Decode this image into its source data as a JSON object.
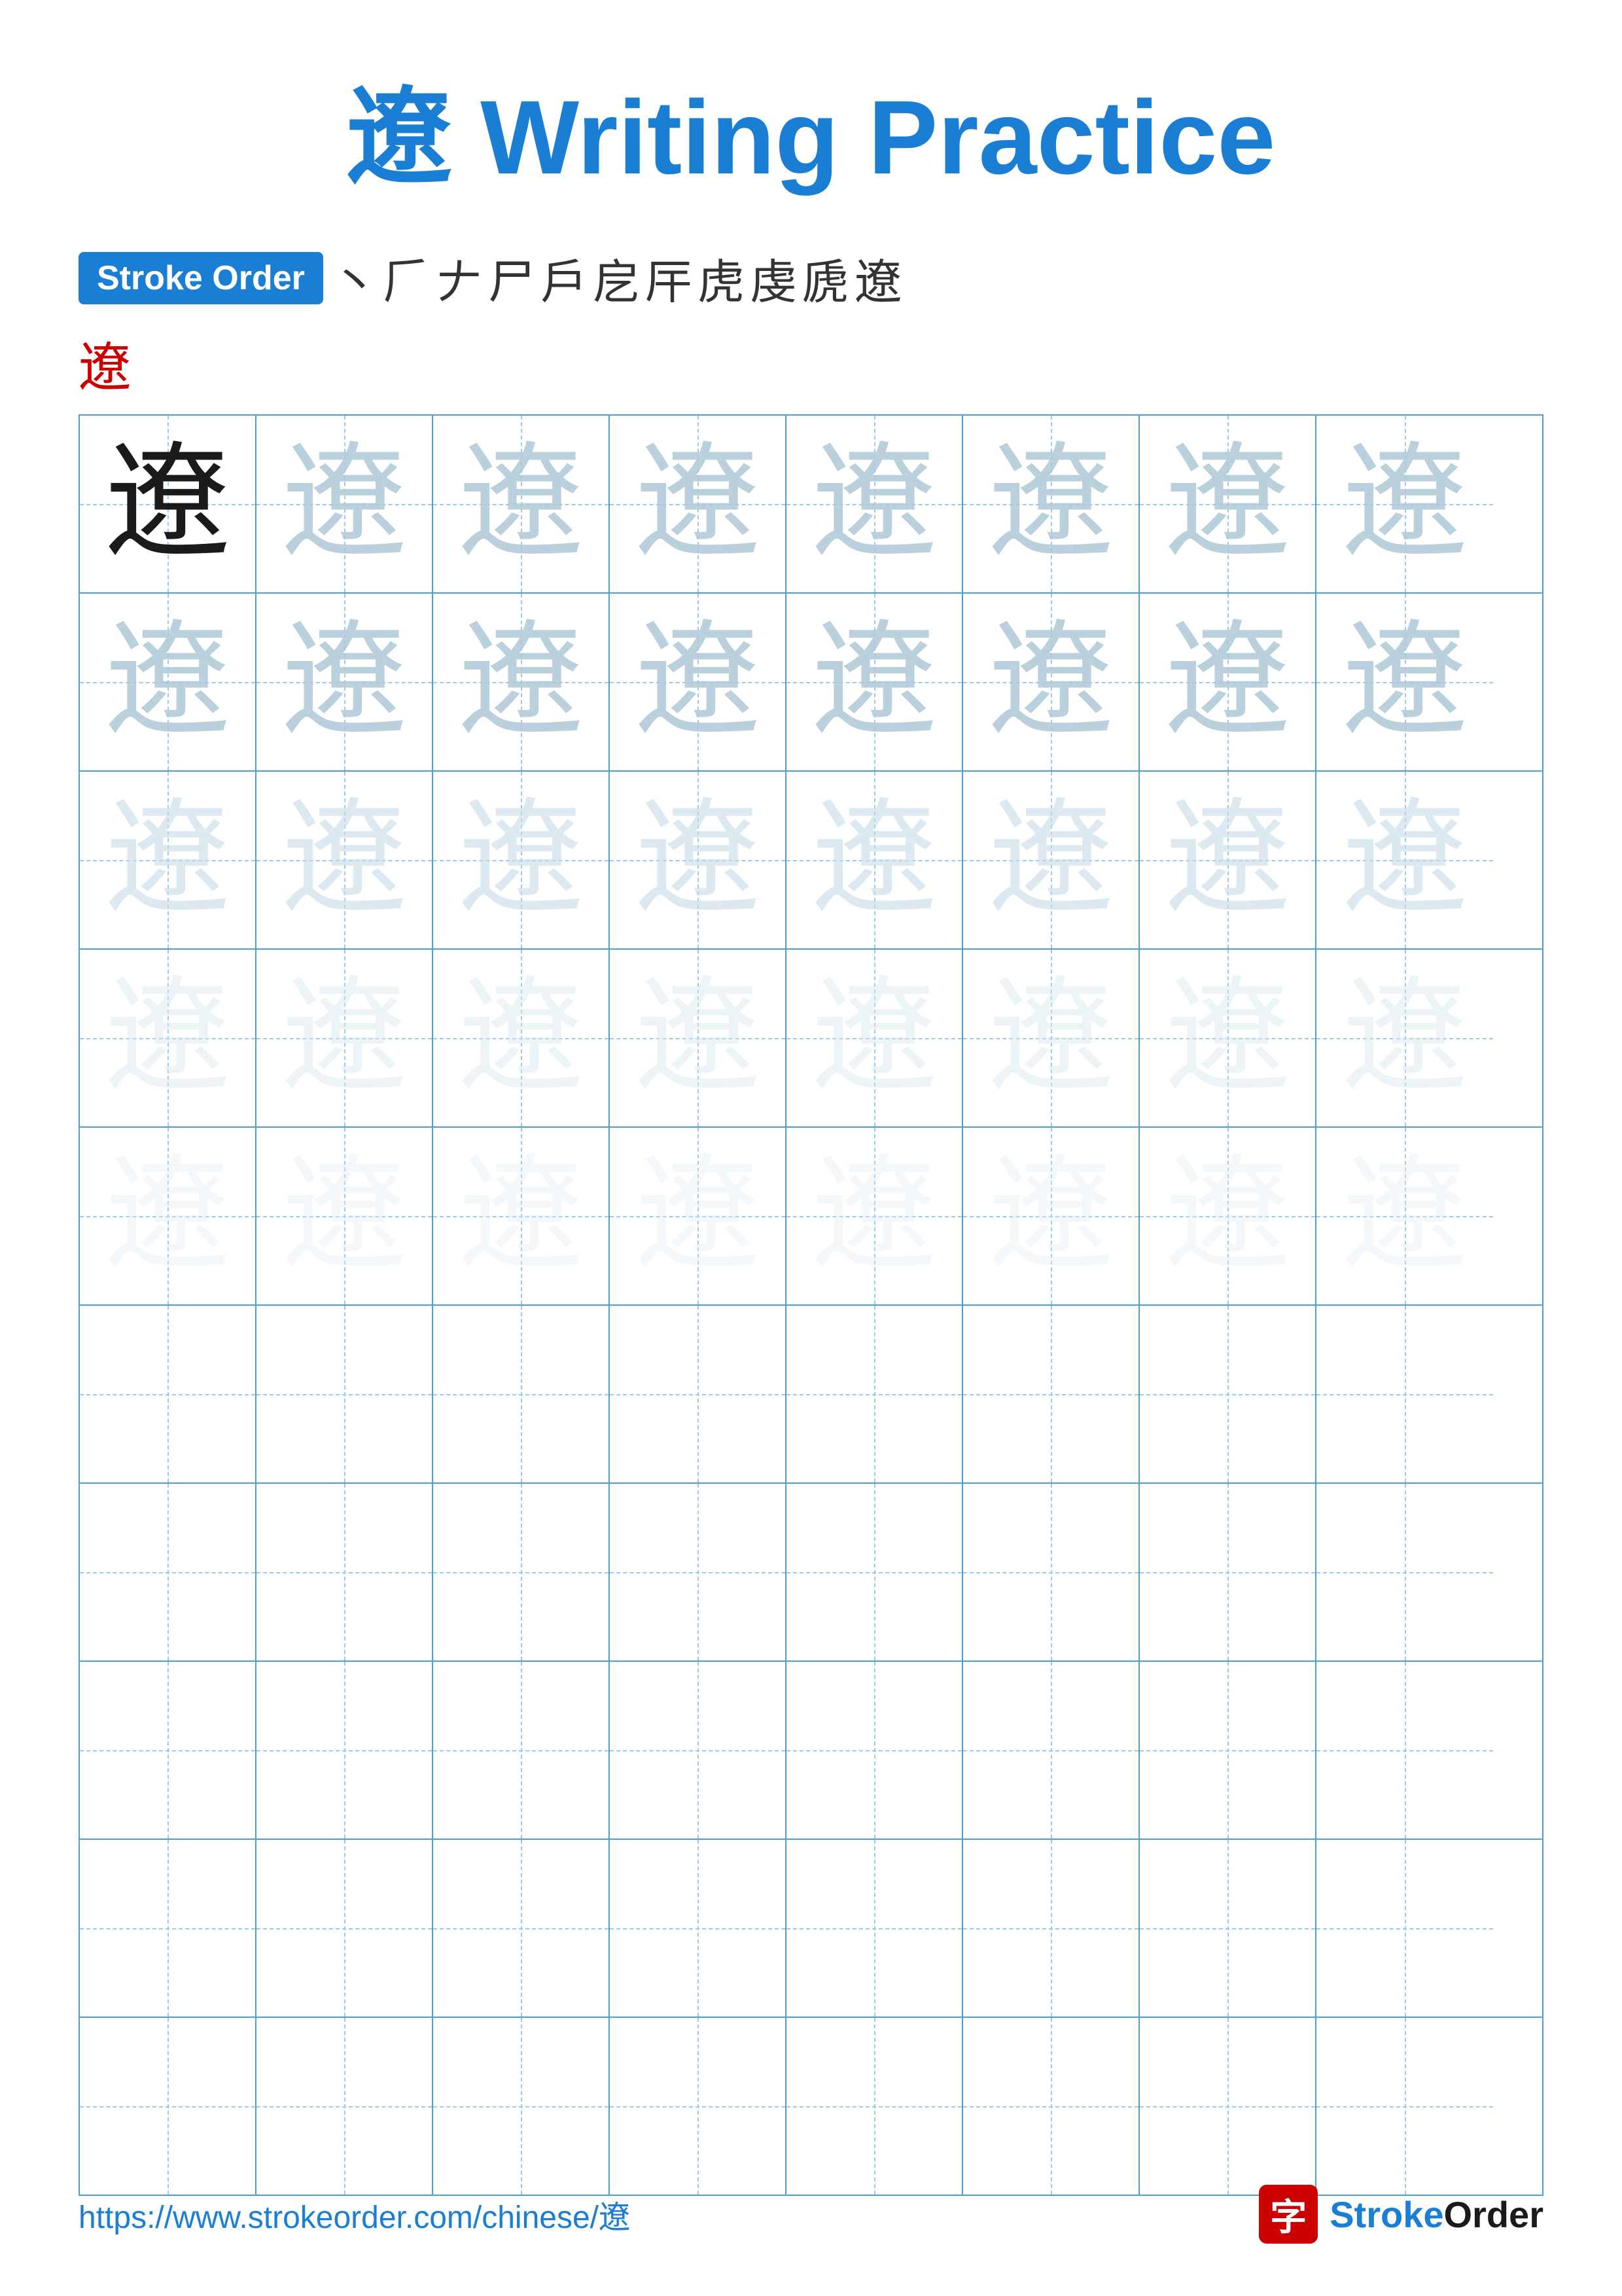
{
  "title": {
    "main": "遼 Writing Practice"
  },
  "stroke_order": {
    "badge_label": "Stroke Order",
    "sequence": [
      "丶",
      "𠂆",
      "𠂇",
      "尸",
      "𠂊",
      "𠂋",
      "⺮",
      "虎",
      "虎",
      "虒",
      "遼",
      "遼"
    ],
    "sequence_display": [
      "丶",
      "𠂆",
      "𠂇",
      "尸",
      "𠁢",
      "𠂋",
      "𠂌",
      "虎",
      "虎",
      "虒",
      "遼"
    ],
    "char": "遼",
    "char_raw": "遼"
  },
  "grid": {
    "char": "遼",
    "cols": 8,
    "rows": 10,
    "practice_rows": 5,
    "empty_rows": 5,
    "opacity_levels": [
      "dark",
      "medium",
      "light",
      "lighter",
      "lightest"
    ]
  },
  "footer": {
    "url": "https://www.strokeorder.com/chinese/遼",
    "logo_icon": "字",
    "logo_text": "StrokeOrder"
  }
}
